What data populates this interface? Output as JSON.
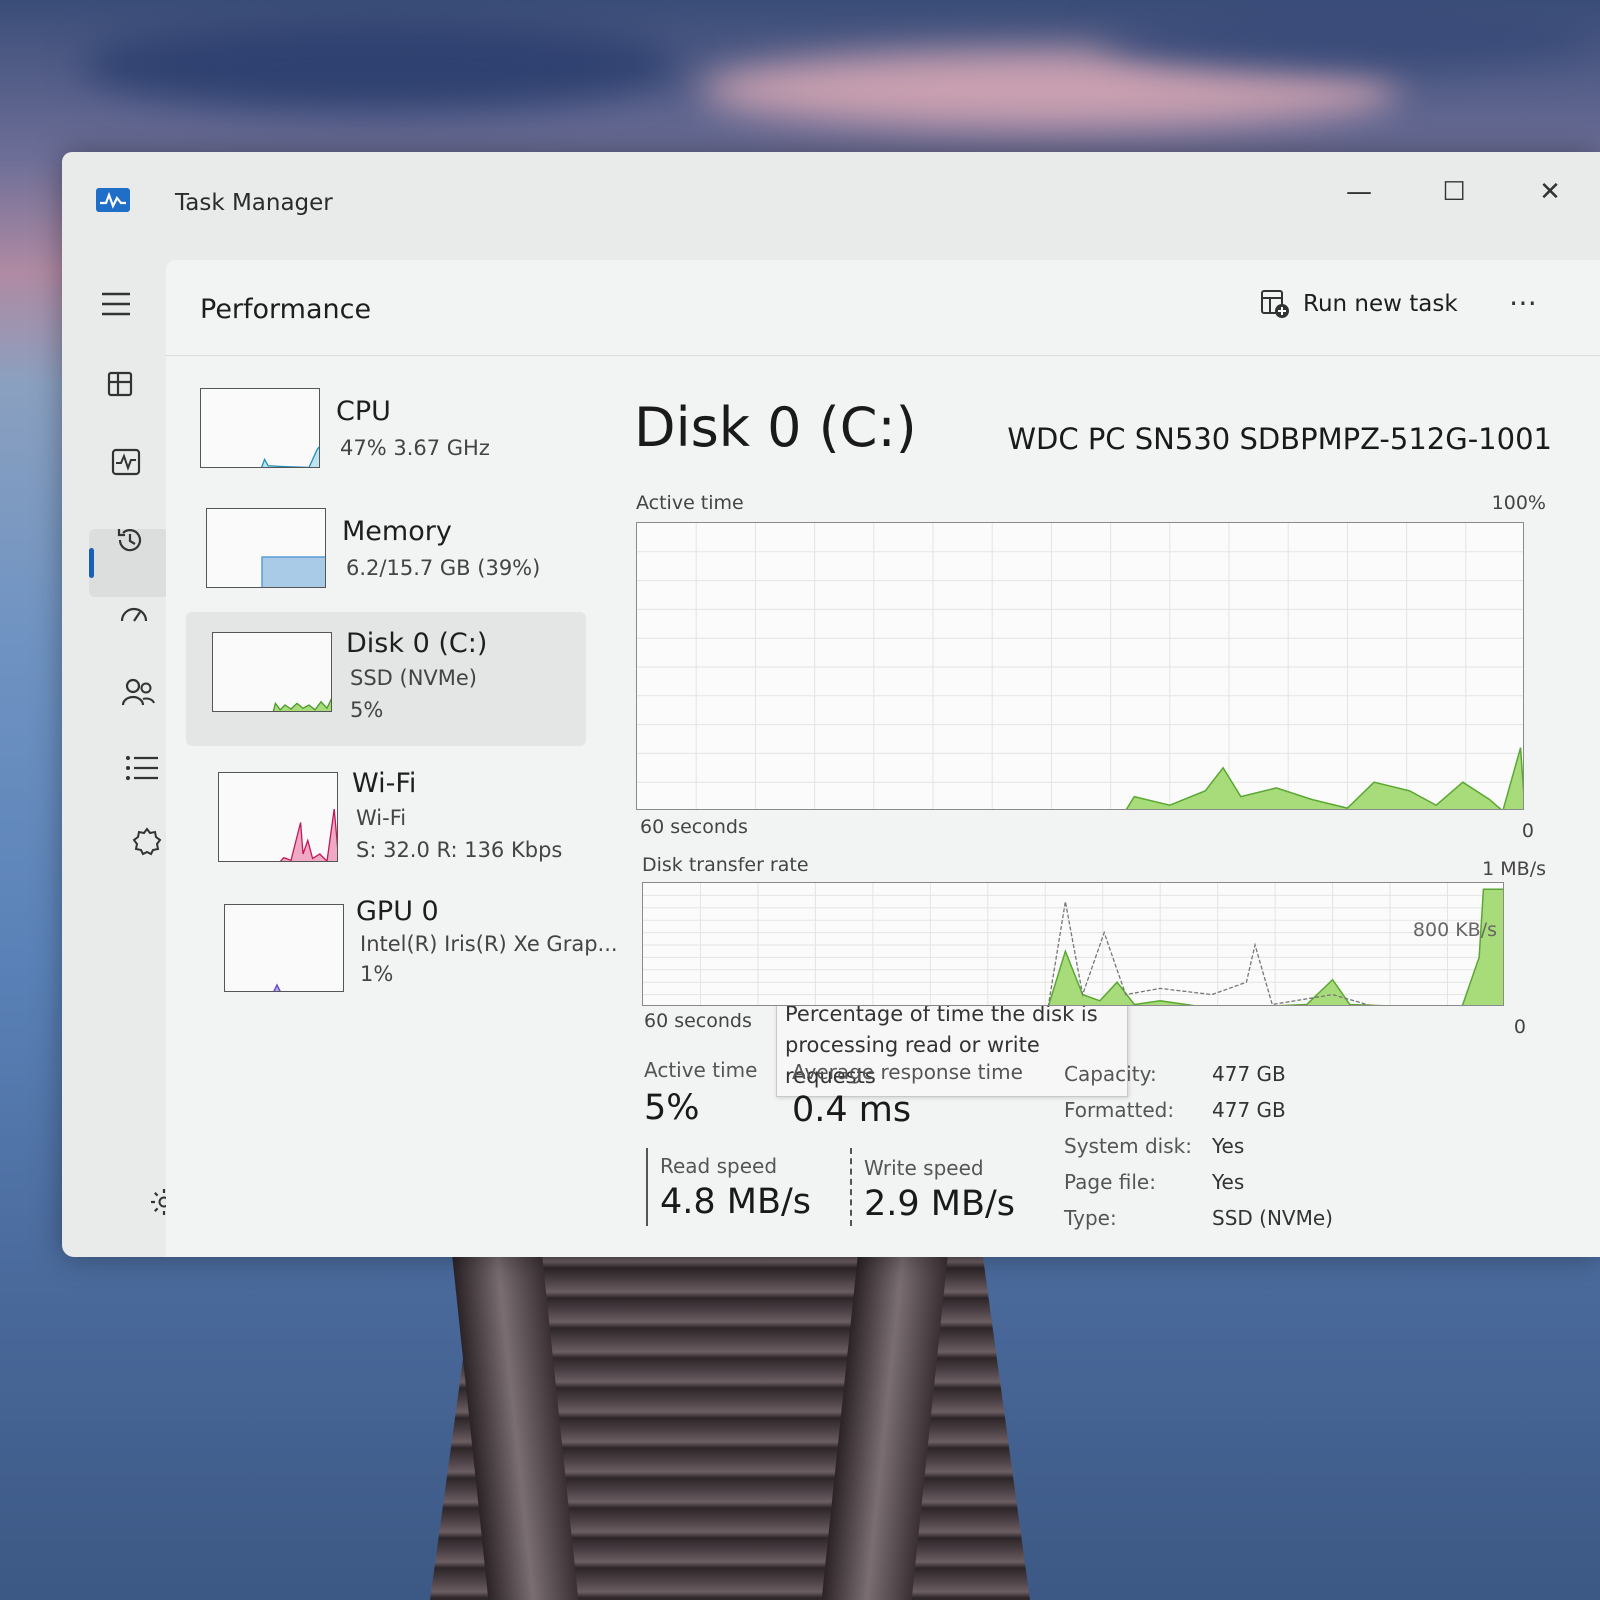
{
  "window": {
    "title": "Task Manager",
    "controls": {
      "minimize": "—",
      "maximize": "☐",
      "close": "✕"
    }
  },
  "header": {
    "page_title": "Performance",
    "run_new_task": "Run new task",
    "more": "⋯"
  },
  "sidebar": {
    "items": [
      {
        "name": "menu-icon"
      },
      {
        "name": "processes-icon"
      },
      {
        "name": "performance-icon",
        "active": true
      },
      {
        "name": "app-history-icon"
      },
      {
        "name": "startup-apps-icon"
      },
      {
        "name": "users-icon"
      },
      {
        "name": "details-icon"
      },
      {
        "name": "services-icon"
      },
      {
        "name": "settings-icon"
      }
    ]
  },
  "devices": [
    {
      "name": "CPU",
      "line1": "47%  3.67 GHz",
      "line2": "",
      "color": "#1f8fb8"
    },
    {
      "name": "Memory",
      "line1": "6.2/15.7 GB (39%)",
      "line2": "",
      "color": "#5a9bd5"
    },
    {
      "name": "Disk 0 (C:)",
      "line1": "SSD (NVMe)",
      "line2": "5%",
      "color": "#4caf50",
      "selected": true
    },
    {
      "name": "Wi-Fi",
      "line1": "Wi-Fi",
      "line2": "S: 32.0  R: 136 Kbps",
      "color": "#c2185b"
    },
    {
      "name": "GPU 0",
      "line1": "Intel(R) Iris(R) Xe Grap...",
      "line2": "1%",
      "color": "#6a4fc9"
    }
  ],
  "disk": {
    "title": "Disk 0 (C:)",
    "model": "WDC PC SN530 SDBPMPZ-512G-1001",
    "active_chart": {
      "label": "Active time",
      "max_label": "100%",
      "time_label": "60 seconds",
      "min_label": "0",
      "tooltip": "Percentage of time the disk is processing read or write requests"
    },
    "transfer_chart": {
      "label": "Disk transfer rate",
      "max_label": "1 MB/s",
      "mid_label": "800 KB/s",
      "time_label": "60 seconds",
      "min_label": "0"
    },
    "stats": {
      "active_time_label": "Active time",
      "active_time_value": "5%",
      "avg_response_label": "Average response time",
      "avg_response_value": "0.4 ms",
      "read_speed_label": "Read speed",
      "read_speed_value": "4.8 MB/s",
      "write_speed_label": "Write speed",
      "write_speed_value": "2.9 MB/s"
    },
    "info": [
      {
        "key": "Capacity:",
        "value": "477 GB"
      },
      {
        "key": "Formatted:",
        "value": "477 GB"
      },
      {
        "key": "System disk:",
        "value": "Yes"
      },
      {
        "key": "Page file:",
        "value": "Yes"
      },
      {
        "key": "Type:",
        "value": "SSD (NVMe)"
      }
    ]
  },
  "colors": {
    "disk_fill": "#9ed66a",
    "disk_line": "#4a9a2a",
    "accent": "#1a5fb4"
  }
}
